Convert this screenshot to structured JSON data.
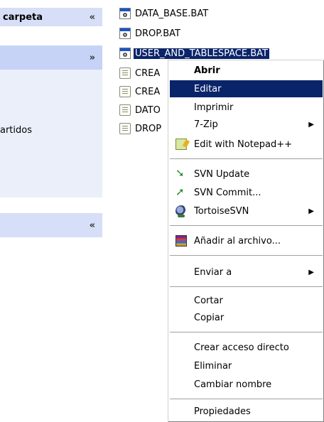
{
  "task_pane": {
    "section1": {
      "title": "carpeta",
      "chevron": "«"
    },
    "section2": {
      "chevron": "»",
      "text": "artidos"
    },
    "section3": {
      "chevron": "«"
    }
  },
  "files": [
    {
      "name": "DATA_BASE.BAT",
      "icon": "bat-file-icon"
    },
    {
      "name": "DROP.BAT",
      "icon": "bat-file-icon"
    },
    {
      "name": "USER_AND_TABLESPACE.BAT",
      "icon": "bat-file-icon",
      "selected": true
    },
    {
      "name": "CREA",
      "icon": "text-file-icon"
    },
    {
      "name": "CREA",
      "icon": "text-file-icon"
    },
    {
      "name": "DATO",
      "icon": "text-file-icon"
    },
    {
      "name": "DROP",
      "icon": "text-file-icon"
    }
  ],
  "context_menu": {
    "abrir": "Abrir",
    "editar": "Editar",
    "imprimir": "Imprimir",
    "sevenzip": "7-Zip",
    "notepad": "Edit with Notepad++",
    "svn_update": "SVN Update",
    "svn_commit": "SVN Commit...",
    "tortoise": "TortoiseSVN",
    "anadir": "Añadir al archivo...",
    "enviar": "Enviar a",
    "cortar": "Cortar",
    "copiar": "Copiar",
    "crear_acceso": "Crear acceso directo",
    "eliminar": "Eliminar",
    "cambiar_nombre": "Cambiar nombre",
    "propiedades": "Propiedades",
    "submenu_arrow": "▶"
  },
  "colors": {
    "selection": "#0a246a",
    "pane_header": "#d6dff7",
    "pane_body": "#eaeff9"
  }
}
